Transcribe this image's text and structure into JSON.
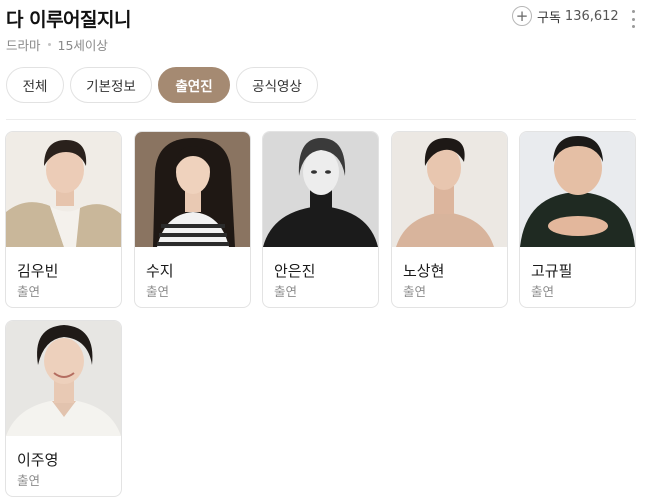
{
  "header": {
    "title": "다 이루어질지니",
    "genre": "드라마",
    "rating": "15세이상",
    "subscribe_label": "구독",
    "subscribe_count": "136,612"
  },
  "tabs": [
    {
      "label": "전체",
      "active": false
    },
    {
      "label": "기본정보",
      "active": false
    },
    {
      "label": "출연진",
      "active": true
    },
    {
      "label": "공식영상",
      "active": false
    }
  ],
  "colors": {
    "accent": "#a58a72",
    "muted_text": "#8c8c8c",
    "card_border": "#e3e3e3"
  },
  "cast": [
    {
      "name": "김우빈",
      "role": "출연",
      "photo_icon": "portrait-photo"
    },
    {
      "name": "수지",
      "role": "출연",
      "photo_icon": "portrait-photo"
    },
    {
      "name": "안은진",
      "role": "출연",
      "photo_icon": "portrait-photo"
    },
    {
      "name": "노상현",
      "role": "출연",
      "photo_icon": "portrait-photo"
    },
    {
      "name": "고규필",
      "role": "출연",
      "photo_icon": "portrait-photo"
    },
    {
      "name": "이주영",
      "role": "출연",
      "photo_icon": "portrait-photo"
    }
  ]
}
